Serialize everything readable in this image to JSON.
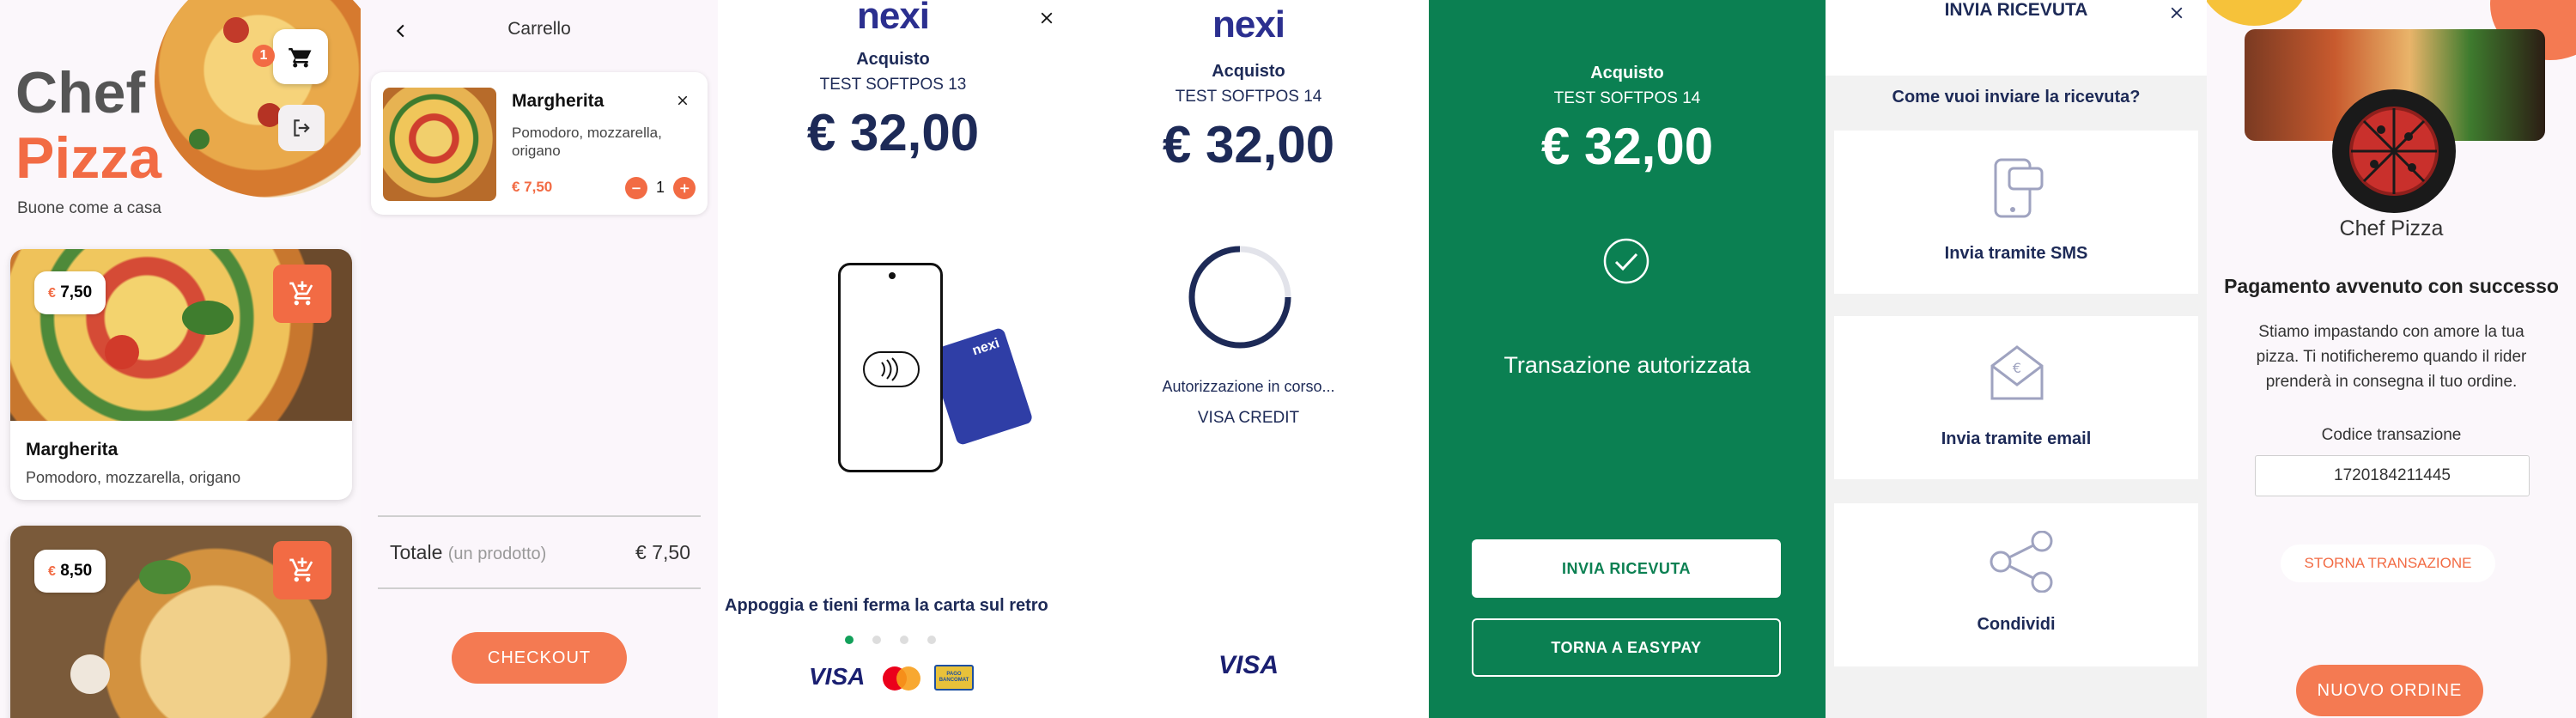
{
  "colors": {
    "accent": "#f26b44",
    "navy": "#1d2a57",
    "nexi_blue": "#2b2f8f",
    "success_green": "#0b8052"
  },
  "menu": {
    "title_line1": "Chef",
    "title_line2": "Pizza",
    "subtitle": "Buone come a casa",
    "cart_badge": "1",
    "cart_icon": "cart-icon",
    "logout_icon": "logout-icon",
    "products": [
      {
        "price": "7,50",
        "name": "Margherita",
        "description": "Pomodoro, mozzarella, origano"
      },
      {
        "price": "8,50"
      }
    ],
    "currency": "€"
  },
  "cart": {
    "title": "Carrello",
    "item": {
      "name": "Margherita",
      "description": "Pomodoro, mozzarella, origano",
      "price": "€ 7,50",
      "quantity": "1"
    },
    "total_label": "Totale",
    "total_note": "(un prodotto)",
    "total_value": "€ 7,50",
    "checkout_label": "CHECKOUT"
  },
  "payment_tap": {
    "brand": "nexi",
    "label": "Acquisto",
    "merchant": "TEST SOFTPOS 13",
    "amount": "€ 32,00",
    "card_brand_label": "nexi",
    "instruction": "Appoggia e tieni ferma la carta sul retro",
    "visa": "VISA",
    "bancomat_label": "PAGO BANCOMAT"
  },
  "payment_processing": {
    "brand": "nexi",
    "label": "Acquisto",
    "merchant": "TEST SOFTPOS 14",
    "amount": "€ 32,00",
    "status": "Autorizzazione in corso...",
    "card_type": "VISA CREDIT",
    "visa": "VISA"
  },
  "payment_done": {
    "label": "Acquisto",
    "merchant": "TEST SOFTPOS 14",
    "amount": "€ 32,00",
    "status": "Transazione autorizzata",
    "receipt_button": "INVIA RICEVUTA",
    "back_button": "TORNA A EASYPAY"
  },
  "receipt": {
    "title": "INVIA RICEVUTA",
    "question": "Come vuoi inviare la ricevuta?",
    "options": [
      "Invia tramite SMS",
      "Invia tramite email",
      "Condividi"
    ]
  },
  "success": {
    "shop_name": "Chef Pizza",
    "title": "Pagamento avvenuto con successo",
    "message": "Stiamo impastando con amore la tua pizza. Ti notificheremo quando il rider prenderà in consegna il tuo ordine.",
    "code_label": "Codice transazione",
    "code_value": "1720184211445",
    "refund_button": "STORNA TRANSAZIONE",
    "new_order_button": "NUOVO ORDINE"
  }
}
